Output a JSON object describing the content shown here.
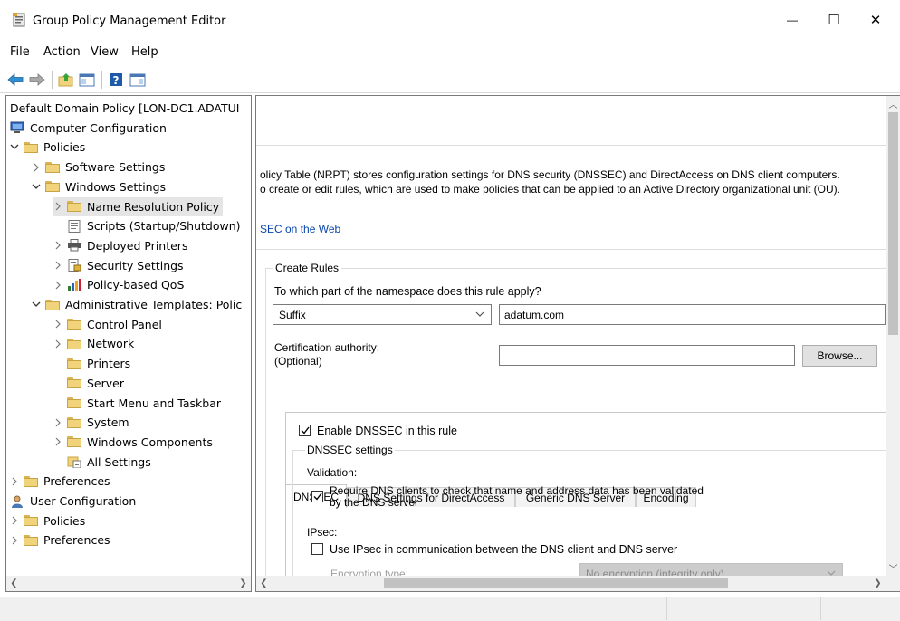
{
  "window": {
    "title": "Group Policy Management Editor",
    "minimize_glyph": "—",
    "maximize_glyph": "☐",
    "close_glyph": "✕"
  },
  "menu": [
    "File",
    "Action",
    "View",
    "Help"
  ],
  "toolbar": {
    "icons": [
      "back-arrow-icon",
      "forward-arrow-icon",
      "up-folder-icon",
      "show-hide-tree-icon",
      "help-icon",
      "properties-pane-icon"
    ]
  },
  "tree": [
    {
      "label": "Default Domain Policy [LON-DC1.ADATUI",
      "indent": 0,
      "expander": "none",
      "icon": "none"
    },
    {
      "label": "Computer Configuration",
      "indent": 0,
      "expander": "none",
      "icon": "computer-icon"
    },
    {
      "label": "Policies",
      "indent": 1,
      "expander": "open",
      "icon": "folder-icon"
    },
    {
      "label": "Software Settings",
      "indent": 2,
      "expander": "closed",
      "icon": "folder-icon"
    },
    {
      "label": "Windows Settings",
      "indent": 2,
      "expander": "open",
      "icon": "folder-icon"
    },
    {
      "label": "Name Resolution Policy",
      "indent": 3,
      "expander": "closed",
      "icon": "folder-icon",
      "selected": true
    },
    {
      "label": "Scripts (Startup/Shutdown)",
      "indent": 3,
      "expander": "none",
      "icon": "script-icon"
    },
    {
      "label": "Deployed Printers",
      "indent": 3,
      "expander": "closed",
      "icon": "printer-icon"
    },
    {
      "label": "Security Settings",
      "indent": 3,
      "expander": "closed",
      "icon": "security-icon"
    },
    {
      "label": "Policy-based QoS",
      "indent": 3,
      "expander": "closed",
      "icon": "qos-chart-icon"
    },
    {
      "label": "Administrative Templates: Polic",
      "indent": 2,
      "expander": "open",
      "icon": "folder-icon"
    },
    {
      "label": "Control Panel",
      "indent": 3,
      "expander": "closed",
      "icon": "folder-icon"
    },
    {
      "label": "Network",
      "indent": 3,
      "expander": "closed",
      "icon": "folder-icon"
    },
    {
      "label": "Printers",
      "indent": 3,
      "expander": "none",
      "icon": "folder-icon"
    },
    {
      "label": "Server",
      "indent": 3,
      "expander": "none",
      "icon": "folder-icon"
    },
    {
      "label": "Start Menu and Taskbar",
      "indent": 3,
      "expander": "none",
      "icon": "folder-icon"
    },
    {
      "label": "System",
      "indent": 3,
      "expander": "closed",
      "icon": "folder-icon"
    },
    {
      "label": "Windows Components",
      "indent": 3,
      "expander": "closed",
      "icon": "folder-icon"
    },
    {
      "label": "All Settings",
      "indent": 3,
      "expander": "none",
      "icon": "all-settings-icon"
    },
    {
      "label": "Preferences",
      "indent": 1,
      "expander": "closed",
      "icon": "folder-icon"
    },
    {
      "label": "User Configuration",
      "indent": 0,
      "expander": "none",
      "icon": "user-icon"
    },
    {
      "label": "Policies",
      "indent": 1,
      "expander": "closed",
      "icon": "folder-icon"
    },
    {
      "label": "Preferences",
      "indent": 1,
      "expander": "closed",
      "icon": "folder-icon"
    }
  ],
  "content": {
    "intro_line1": "olicy Table (NRPT) stores configuration settings for DNS security (DNSSEC) and DirectAccess on DNS client computers.",
    "intro_line2": "o create or edit rules, which are used to make policies that can be applied to an Active Directory organizational unit (OU).",
    "web_link": "SEC on the Web",
    "create_rules": {
      "title": "Create Rules",
      "namespace_question": "To which part of the namespace does this rule apply?",
      "namespace_type": "Suffix",
      "namespace_value": "adatum.com",
      "cert_label_1": "Certification authority:",
      "cert_label_2": "(Optional)",
      "cert_value": "",
      "browse_label": "Browse..."
    },
    "tabs": [
      "DNSSEC",
      "DNS Settings for DirectAccess",
      "Generic DNS Server",
      "Encoding"
    ],
    "dnssec": {
      "enable_label": "Enable DNSSEC in this rule",
      "enable_checked": true,
      "settings_title": "DNSSEC settings",
      "validation_label": "Validation:",
      "require_label_1": "Require DNS clients to check that name and address data has been validated",
      "require_label_2": "by the DNS server",
      "require_checked": true,
      "ipsec_label": "IPsec:",
      "use_ipsec_label": "Use IPsec in communication between the DNS client and DNS server",
      "use_ipsec_checked": false,
      "encryption_label": "Encryption type:",
      "encryption_value": "No encryption (integrity only)"
    }
  }
}
